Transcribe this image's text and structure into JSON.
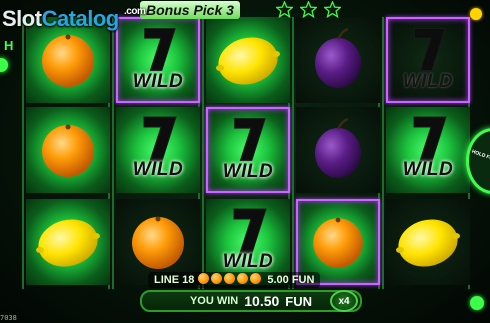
{
  "watermark": {
    "brand_a": "Slot",
    "brand_b": "Catalog",
    "suffix": ".com"
  },
  "header": {
    "title": "Bonus Pick 3",
    "stars_count": 3,
    "star_color": "#3dff4a"
  },
  "side_left": {
    "letter": "H"
  },
  "hold_button": {
    "label": "HOLD FOR"
  },
  "reels": [
    [
      {
        "symbol": "orange",
        "win": false,
        "lit": true
      },
      {
        "symbol": "orange",
        "win": false,
        "lit": true
      },
      {
        "symbol": "lemon",
        "win": false,
        "lit": true
      }
    ],
    [
      {
        "symbol": "wild",
        "win": true,
        "lit": true
      },
      {
        "symbol": "wild",
        "win": false,
        "lit": true
      },
      {
        "symbol": "orange",
        "win": false,
        "lit": false
      }
    ],
    [
      {
        "symbol": "lemon",
        "win": false,
        "lit": true
      },
      {
        "symbol": "wild",
        "win": true,
        "lit": true
      },
      {
        "symbol": "wild",
        "win": false,
        "lit": true
      }
    ],
    [
      {
        "symbol": "plum",
        "win": false,
        "lit": false
      },
      {
        "symbol": "plum",
        "win": false,
        "lit": false
      },
      {
        "symbol": "orange",
        "win": true,
        "lit": true
      }
    ],
    [
      {
        "symbol": "wild",
        "win": true,
        "lit": false
      },
      {
        "symbol": "wild",
        "win": false,
        "lit": true
      },
      {
        "symbol": "lemon",
        "win": false,
        "lit": false
      }
    ]
  ],
  "wild_text": "WILD",
  "line_info": {
    "line_label": "LINE 18",
    "symbol_count": 5,
    "amount": "5.00 FUN"
  },
  "win_bar": {
    "label": "YOU WIN",
    "amount": "10.50",
    "currency": "FUN"
  },
  "multiplier": "x4",
  "footer_id": "7038",
  "colors": {
    "accent": "#3dff4a",
    "win_frame": "#c866ff",
    "orange": "#ff9a08",
    "lemon": "#ffe400",
    "plum": "#5a1d86"
  }
}
